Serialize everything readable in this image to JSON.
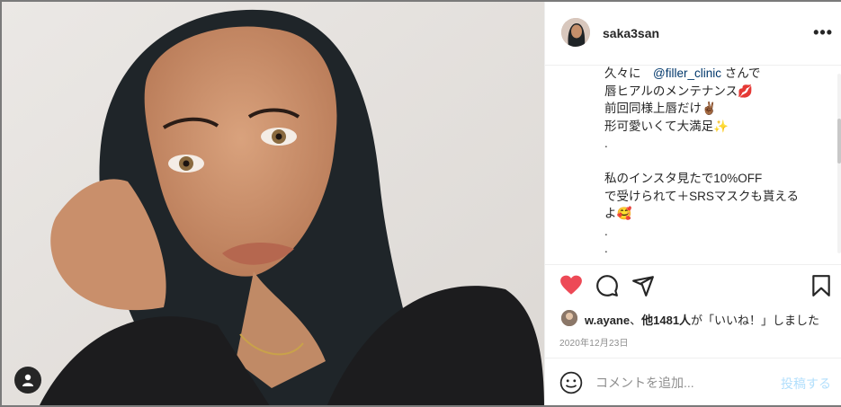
{
  "post": {
    "username": "saka3san",
    "more_label": "•••",
    "caption_lines": [
      {
        "pre": "久々に　",
        "mention": "@filler_clinic",
        "post": " さんで"
      },
      {
        "pre": "唇ヒアルのメンテナンス💋",
        "mention": "",
        "post": ""
      },
      {
        "pre": "前回同様上唇だけ✌🏾",
        "mention": "",
        "post": ""
      },
      {
        "pre": "形可愛いくて大満足✨",
        "mention": "",
        "post": ""
      },
      {
        "pre": ".",
        "mention": "",
        "post": ""
      },
      {
        "pre": "",
        "mention": "",
        "post": ""
      },
      {
        "pre": "私のインスタ見たで10%OFF",
        "mention": "",
        "post": ""
      },
      {
        "pre": "で受けられて＋SRSマスクも貰える",
        "mention": "",
        "post": ""
      },
      {
        "pre": "よ🥰",
        "mention": "",
        "post": ""
      },
      {
        "pre": ".",
        "mention": "",
        "post": ""
      },
      {
        "pre": ".",
        "mention": "",
        "post": ""
      },
      {
        "pre": ".",
        "mention": "",
        "post": ""
      }
    ],
    "likes": {
      "user": "w.ayane",
      "joiner": "、",
      "others": "他1481人",
      "suffix": "が「いいね！」しました"
    },
    "date": "2020年12月23日",
    "comment_placeholder": "コメントを追加...",
    "post_button": "投稿する"
  },
  "icons": {
    "like": "heart-icon",
    "comment": "comment-icon",
    "share": "share-icon",
    "save": "bookmark-icon",
    "emoji": "emoji-icon",
    "user_tag": "user-icon"
  },
  "colors": {
    "like_active": "#ed4956",
    "mention": "#00376b",
    "post_disabled": "#b2dffc",
    "muted": "#8e8e8e"
  }
}
